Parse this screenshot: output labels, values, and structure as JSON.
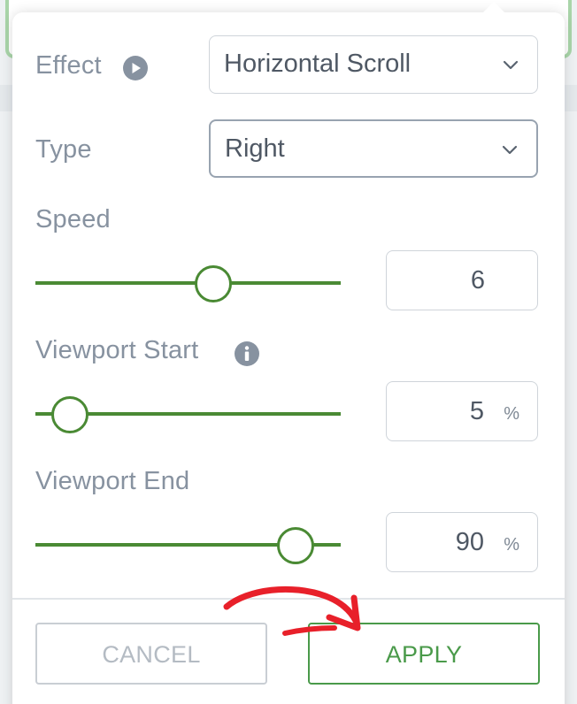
{
  "effect": {
    "label": "Effect",
    "icon": "play-circle-icon",
    "value": "Horizontal Scroll",
    "options_visible": [
      "Horizontal Scroll"
    ]
  },
  "type": {
    "label": "Type",
    "value": "Right"
  },
  "speed": {
    "label": "Speed",
    "value": "6",
    "slider_fraction": 0.58
  },
  "viewport_start": {
    "label": "Viewport Start",
    "icon": "info-icon",
    "value": "5",
    "unit": "%",
    "slider_fraction": 0.11
  },
  "viewport_end": {
    "label": "Viewport End",
    "value": "90",
    "unit": "%",
    "slider_fraction": 0.85
  },
  "buttons": {
    "cancel": "CANCEL",
    "apply": "APPLY"
  },
  "colors": {
    "accent_green": "#4a8a34",
    "apply_green": "#4a9a4a",
    "label_gray": "#8792a0",
    "annotation_red": "#e8202a"
  }
}
